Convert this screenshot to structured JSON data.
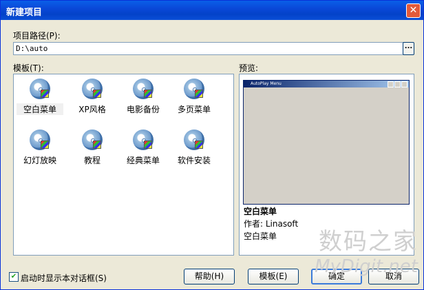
{
  "window": {
    "title": "新建项目",
    "close_glyph": "✕"
  },
  "path": {
    "label": "项目路径(P):",
    "value": "D:\\auto",
    "browse_label": "..."
  },
  "templates": {
    "label": "模板(T):",
    "items": [
      {
        "name": "空白菜单"
      },
      {
        "name": "XP风格"
      },
      {
        "name": "电影备份"
      },
      {
        "name": "多页菜单"
      },
      {
        "name": "幻灯放映"
      },
      {
        "name": "教程"
      },
      {
        "name": "经典菜单"
      },
      {
        "name": "软件安装"
      }
    ]
  },
  "preview": {
    "label": "预览:",
    "window_title": "AutoPlay Menu",
    "name": "空白菜单",
    "author": "作者: Linasoft",
    "description": "空白菜单"
  },
  "footer": {
    "show_on_start_label": "启动时显示本对话框(S)",
    "show_on_start_checked": true,
    "help_label": "帮助(H)",
    "template_label": "模板(E)",
    "ok_label": "确定",
    "cancel_label": "取消"
  },
  "watermark": {
    "cn": "数码之家",
    "en": "MyDigit.net"
  }
}
